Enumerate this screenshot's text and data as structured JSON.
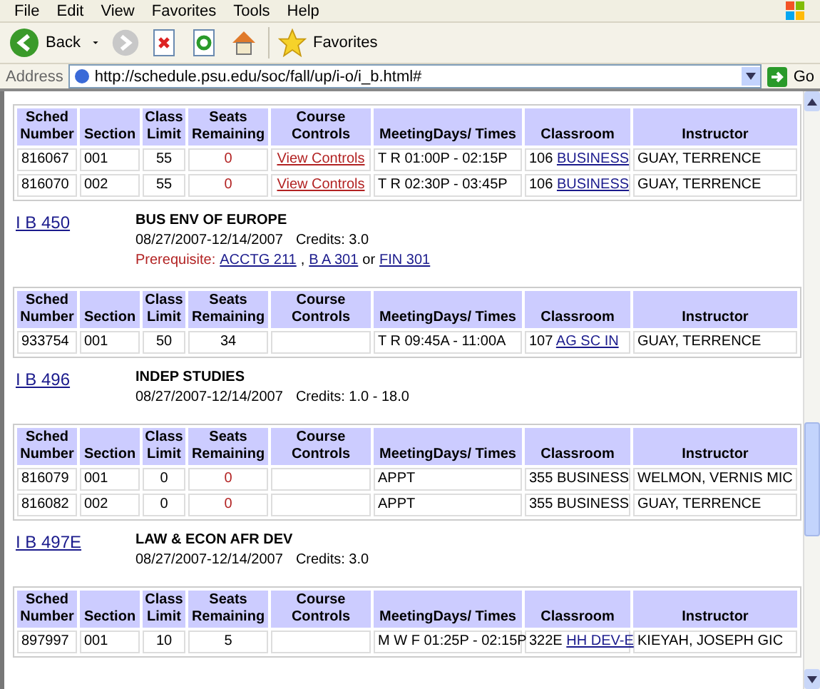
{
  "menu": [
    "File",
    "Edit",
    "View",
    "Favorites",
    "Tools",
    "Help"
  ],
  "toolbar": {
    "back": "Back",
    "forward_disabled": true,
    "favorites": "Favorites"
  },
  "address": {
    "label": "Address",
    "url": "http://schedule.psu.edu/soc/fall/up/i-o/i_b.html#",
    "go": "Go"
  },
  "blocks": [
    {
      "table": {
        "columns": [
          "Sched Number",
          "Section",
          "Class Limit",
          "Seats Remaining",
          "Course Controls",
          "MeetingDays/ Times",
          "Classroom",
          "Instructor"
        ],
        "rows": [
          {
            "sched": "816067",
            "section": "001",
            "limit": "55",
            "seats": "0",
            "full": true,
            "controls": "View Controls",
            "times": "T R 01:00P - 02:15P",
            "room": "106",
            "building": "BUSINESS",
            "linked": true,
            "instructor": "GUAY, TERRENCE"
          },
          {
            "sched": "816070",
            "section": "002",
            "limit": "55",
            "seats": "0",
            "full": true,
            "controls": "View Controls",
            "times": "T R 02:30P - 03:45P",
            "room": "106",
            "building": "BUSINESS",
            "linked": true,
            "instructor": "GUAY, TERRENCE"
          }
        ]
      }
    },
    {
      "course": {
        "code": "I B 450",
        "title": "BUS ENV OF EUROPE",
        "dates": "08/27/2007-12/14/2007",
        "credits": "Credits: 3.0",
        "prerequisite": {
          "label": "Prerequisite:",
          "links": [
            "ACCTG 211",
            "B A 301",
            "FIN 301"
          ],
          "separators": [
            ",",
            "or"
          ]
        }
      },
      "table": {
        "columns": [
          "Sched Number",
          "Section",
          "Class Limit",
          "Seats Remaining",
          "Course Controls",
          "MeetingDays/ Times",
          "Classroom",
          "Instructor"
        ],
        "rows": [
          {
            "sched": "933754",
            "section": "001",
            "limit": "50",
            "seats": "34",
            "full": false,
            "controls": null,
            "times": "T R 09:45A - 11:00A",
            "room": "107",
            "building": "AG SC IN",
            "linked": true,
            "instructor": "GUAY, TERRENCE"
          }
        ]
      }
    },
    {
      "course": {
        "code": "I B 496",
        "title": "INDEP STUDIES",
        "dates": "08/27/2007-12/14/2007",
        "credits": "Credits: 1.0 - 18.0"
      },
      "table": {
        "columns": [
          "Sched Number",
          "Section",
          "Class Limit",
          "Seats Remaining",
          "Course Controls",
          "MeetingDays/ Times",
          "Classroom",
          "Instructor"
        ],
        "rows": [
          {
            "sched": "816079",
            "section": "001",
            "limit": "0",
            "seats": "0",
            "full": true,
            "controls": null,
            "times": "APPT",
            "room": "355",
            "building": "BUSINESS",
            "linked": false,
            "instructor": "WELMON, VERNIS MIC"
          },
          {
            "sched": "816082",
            "section": "002",
            "limit": "0",
            "seats": "0",
            "full": true,
            "controls": null,
            "times": "APPT",
            "room": "355",
            "building": "BUSINESS",
            "linked": false,
            "instructor": "GUAY, TERRENCE"
          }
        ]
      }
    },
    {
      "course": {
        "code": "I B 497E",
        "title": "LAW & ECON AFR DEV",
        "dates": "08/27/2007-12/14/2007",
        "credits": "Credits: 3.0"
      },
      "table": {
        "columns": [
          "Sched Number",
          "Section",
          "Class Limit",
          "Seats Remaining",
          "Course Controls",
          "MeetingDays/ Times",
          "Classroom",
          "Instructor"
        ],
        "rows": [
          {
            "sched": "897997",
            "section": "001",
            "limit": "10",
            "seats": "5",
            "full": false,
            "controls": null,
            "times": "M W F 01:25P - 02:15P",
            "room": "322E",
            "building": "HH DEV-E",
            "linked": true,
            "instructor": "KIEYAH, JOSEPH GIC"
          }
        ]
      }
    }
  ]
}
